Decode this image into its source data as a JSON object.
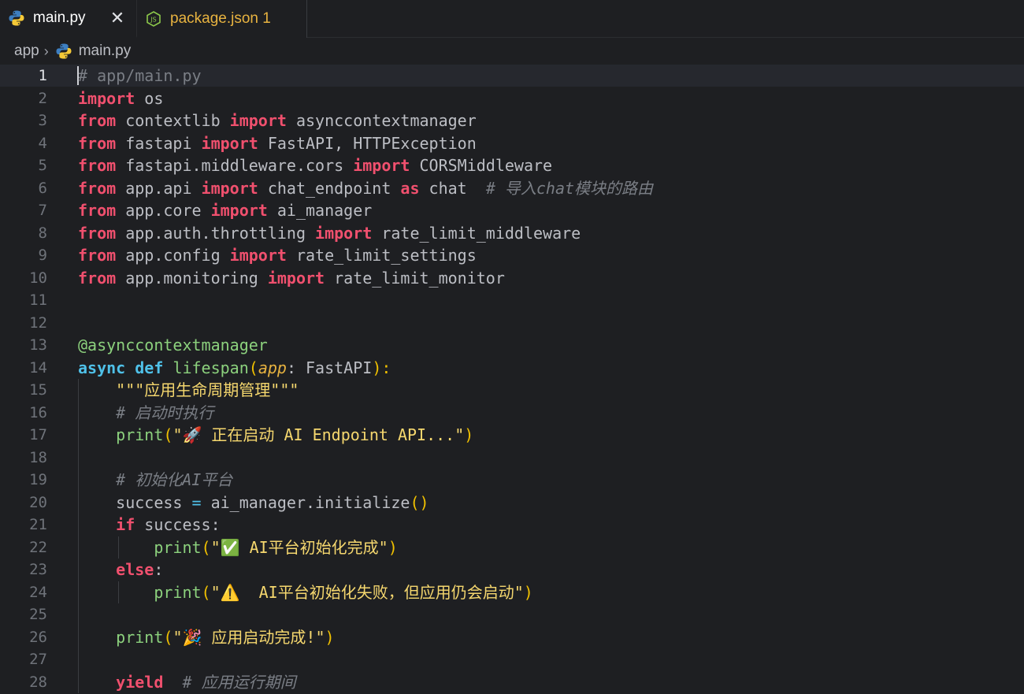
{
  "tabs": [
    {
      "label": "main.py",
      "icon": "python-icon",
      "active": true,
      "close": "✕"
    },
    {
      "label": "package.json 1",
      "icon": "json-icon",
      "active": false
    }
  ],
  "breadcrumb": {
    "folder": "app",
    "file": "main.py"
  },
  "editor": {
    "current_line": 1,
    "line_numbers": [
      "1",
      "2",
      "3",
      "4",
      "5",
      "6",
      "7",
      "8",
      "9",
      "10",
      "11",
      "12",
      "13",
      "14",
      "15",
      "16",
      "17",
      "18",
      "19",
      "20",
      "21",
      "22",
      "23",
      "24",
      "25",
      "26",
      "27",
      "28"
    ],
    "lines": [
      [
        {
          "t": "# app/main.py",
          "c": "cmd"
        }
      ],
      [
        {
          "t": "import",
          "c": "kw"
        },
        {
          "t": " os",
          "c": "plain"
        }
      ],
      [
        {
          "t": "from",
          "c": "kw"
        },
        {
          "t": " contextlib ",
          "c": "plain"
        },
        {
          "t": "import",
          "c": "kw"
        },
        {
          "t": " asynccontextmanager",
          "c": "plain"
        }
      ],
      [
        {
          "t": "from",
          "c": "kw"
        },
        {
          "t": " fastapi ",
          "c": "plain"
        },
        {
          "t": "import",
          "c": "kw"
        },
        {
          "t": " FastAPI, HTTPException",
          "c": "plain"
        }
      ],
      [
        {
          "t": "from",
          "c": "kw"
        },
        {
          "t": " fastapi.middleware.cors ",
          "c": "plain"
        },
        {
          "t": "import",
          "c": "kw"
        },
        {
          "t": " CORSMiddleware",
          "c": "plain"
        }
      ],
      [
        {
          "t": "from",
          "c": "kw"
        },
        {
          "t": " app.api ",
          "c": "plain"
        },
        {
          "t": "import",
          "c": "kw"
        },
        {
          "t": " chat_endpoint ",
          "c": "plain"
        },
        {
          "t": "as",
          "c": "kw"
        },
        {
          "t": " chat  ",
          "c": "plain"
        },
        {
          "t": "# 导入chat模块的路由",
          "c": "cm"
        }
      ],
      [
        {
          "t": "from",
          "c": "kw"
        },
        {
          "t": " app.core ",
          "c": "plain"
        },
        {
          "t": "import",
          "c": "kw"
        },
        {
          "t": " ai_manager",
          "c": "plain"
        }
      ],
      [
        {
          "t": "from",
          "c": "kw"
        },
        {
          "t": " app.auth.throttling ",
          "c": "plain"
        },
        {
          "t": "import",
          "c": "kw"
        },
        {
          "t": " rate_limit_middleware",
          "c": "plain"
        }
      ],
      [
        {
          "t": "from",
          "c": "kw"
        },
        {
          "t": " app.config ",
          "c": "plain"
        },
        {
          "t": "import",
          "c": "kw"
        },
        {
          "t": " rate_limit_settings",
          "c": "plain"
        }
      ],
      [
        {
          "t": "from",
          "c": "kw"
        },
        {
          "t": " app.monitoring ",
          "c": "plain"
        },
        {
          "t": "import",
          "c": "kw"
        },
        {
          "t": " rate_limit_monitor",
          "c": "plain"
        }
      ],
      [],
      [],
      [
        {
          "t": "@asynccontextmanager",
          "c": "dec"
        }
      ],
      [
        {
          "t": "async",
          "c": "kw2"
        },
        {
          "t": " ",
          "c": "plain"
        },
        {
          "t": "def",
          "c": "kw2"
        },
        {
          "t": " ",
          "c": "plain"
        },
        {
          "t": "lifespan",
          "c": "fn"
        },
        {
          "t": "(",
          "c": "paren"
        },
        {
          "t": "app",
          "c": "param"
        },
        {
          "t": ": FastAPI",
          "c": "plain"
        },
        {
          "t": "):",
          "c": "paren"
        }
      ],
      [
        {
          "t": "    ",
          "c": "plain"
        },
        {
          "t": "\"\"\"应用生命周期管理\"\"\"",
          "c": "str"
        }
      ],
      [
        {
          "t": "    ",
          "c": "plain"
        },
        {
          "t": "# 启动时执行",
          "c": "cm"
        }
      ],
      [
        {
          "t": "    ",
          "c": "plain"
        },
        {
          "t": "print",
          "c": "fn"
        },
        {
          "t": "(",
          "c": "paren"
        },
        {
          "t": "\"🚀 正在启动 AI Endpoint API...\"",
          "c": "str"
        },
        {
          "t": ")",
          "c": "paren"
        }
      ],
      [],
      [
        {
          "t": "    ",
          "c": "plain"
        },
        {
          "t": "# 初始化AI平台",
          "c": "cm"
        }
      ],
      [
        {
          "t": "    success ",
          "c": "plain"
        },
        {
          "t": "=",
          "c": "op"
        },
        {
          "t": " ai_manager.initialize",
          "c": "plain"
        },
        {
          "t": "()",
          "c": "paren"
        }
      ],
      [
        {
          "t": "    ",
          "c": "plain"
        },
        {
          "t": "if",
          "c": "kw"
        },
        {
          "t": " success:",
          "c": "plain"
        }
      ],
      [
        {
          "t": "        ",
          "c": "plain"
        },
        {
          "t": "print",
          "c": "fn"
        },
        {
          "t": "(",
          "c": "paren"
        },
        {
          "t": "\"✅ AI平台初始化完成\"",
          "c": "str"
        },
        {
          "t": ")",
          "c": "paren"
        }
      ],
      [
        {
          "t": "    ",
          "c": "plain"
        },
        {
          "t": "else",
          "c": "kw"
        },
        {
          "t": ":",
          "c": "plain"
        }
      ],
      [
        {
          "t": "        ",
          "c": "plain"
        },
        {
          "t": "print",
          "c": "fn"
        },
        {
          "t": "(",
          "c": "paren"
        },
        {
          "t": "\"⚠️  AI平台初始化失败，但应用仍会启动\"",
          "c": "str"
        },
        {
          "t": ")",
          "c": "paren"
        }
      ],
      [],
      [
        {
          "t": "    ",
          "c": "plain"
        },
        {
          "t": "print",
          "c": "fn"
        },
        {
          "t": "(",
          "c": "paren"
        },
        {
          "t": "\"🎉 应用启动完成!\"",
          "c": "str"
        },
        {
          "t": ")",
          "c": "paren"
        }
      ],
      [],
      [
        {
          "t": "    ",
          "c": "plain"
        },
        {
          "t": "yield",
          "c": "kw"
        },
        {
          "t": "  ",
          "c": "plain"
        },
        {
          "t": "# 应用运行期间",
          "c": "cm"
        }
      ]
    ]
  }
}
